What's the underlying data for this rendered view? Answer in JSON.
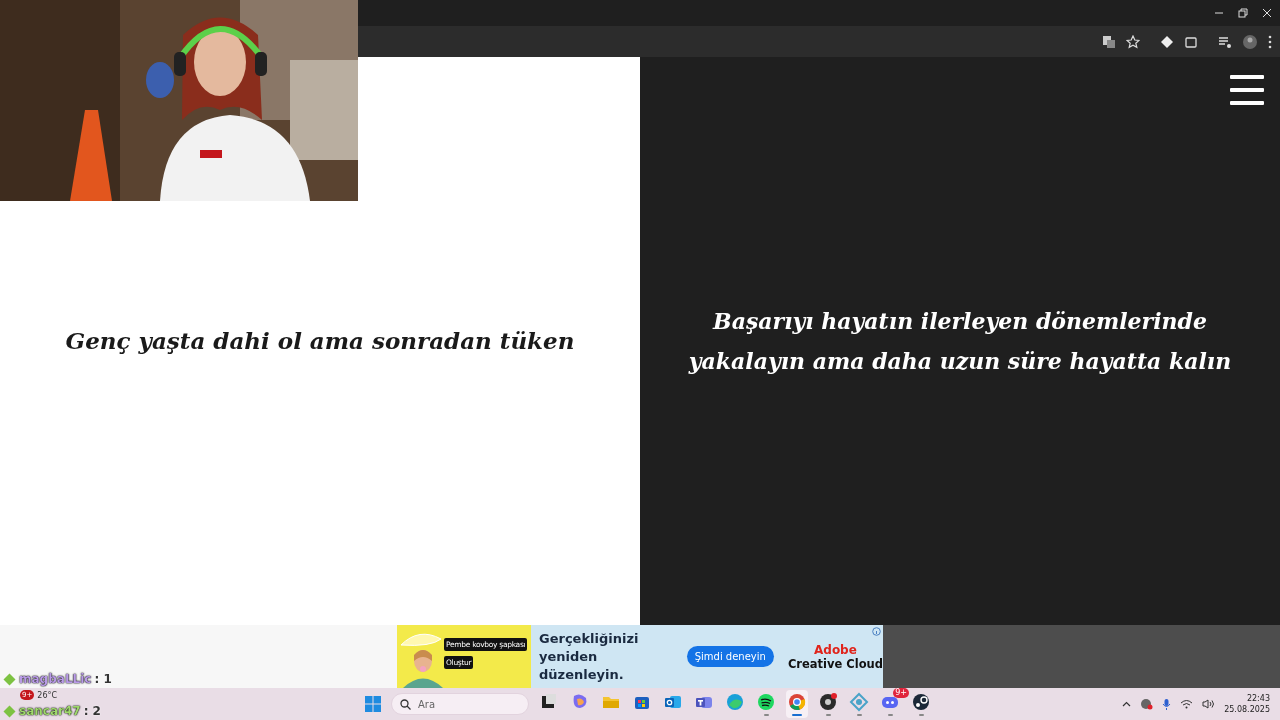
{
  "slides": [
    {
      "dark": false,
      "text": "Genç yaşta dahi ol ama sonradan tüken"
    },
    {
      "dark": true,
      "text": "Başarıyı hayatın ilerleyen dönemlerinde yakalayın ama daha uzun süre hayatta kalın"
    }
  ],
  "ad": {
    "chip": "Pembe kovboy şapkası",
    "chip_action": "Oluştur",
    "headline": "Gerçekliğinizi yeniden düzenleyin.",
    "cta": "Şimdi deneyin",
    "brand": "Adobe",
    "product": "Creative Cloud"
  },
  "chat": [
    {
      "user": "magbaLLic",
      "score": ": 1",
      "color": "#b99be6"
    },
    {
      "user": "sancar47",
      "score": ": 2",
      "color": "#9fd86c"
    }
  ],
  "taskbar": {
    "weather": "26°C",
    "weather_badge": "9+",
    "search": {
      "placeholder": "Ara"
    },
    "apps": [
      {
        "kind": "taskview",
        "running": false,
        "selected": false
      },
      {
        "kind": "copilot",
        "running": false,
        "selected": false
      },
      {
        "kind": "folder",
        "running": false,
        "selected": false
      },
      {
        "kind": "store",
        "running": false,
        "selected": false
      },
      {
        "kind": "mail",
        "running": false,
        "selected": false
      },
      {
        "kind": "teams",
        "running": false,
        "selected": false
      },
      {
        "kind": "edge",
        "running": false,
        "selected": false
      },
      {
        "kind": "music",
        "running": true,
        "selected": false
      },
      {
        "kind": "browser",
        "running": true,
        "selected": true
      },
      {
        "kind": "record",
        "running": true,
        "selected": false
      },
      {
        "kind": "network",
        "running": true,
        "selected": false
      },
      {
        "kind": "chat",
        "running": true,
        "selected": false,
        "badge": "9+"
      },
      {
        "kind": "game",
        "running": true,
        "selected": false
      }
    ],
    "time": "22:43",
    "date": "25.08.2025"
  }
}
